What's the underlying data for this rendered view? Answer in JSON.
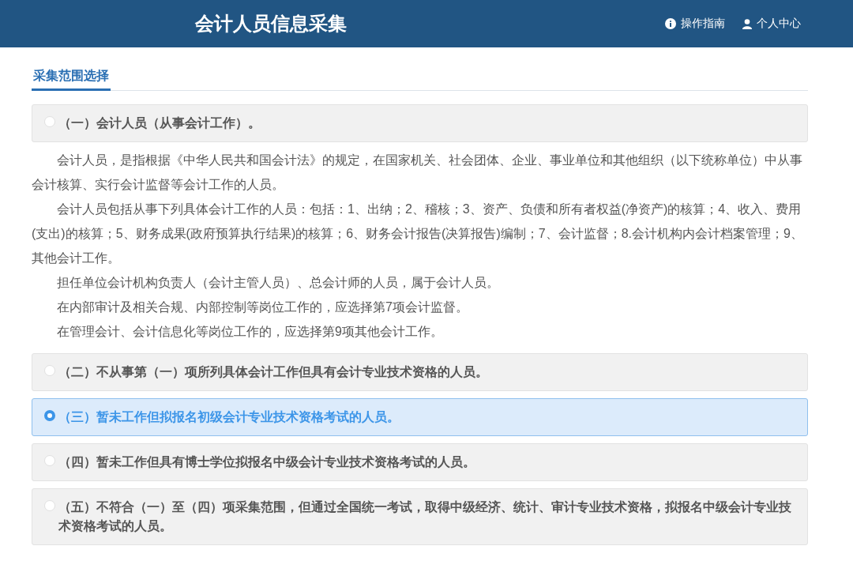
{
  "header": {
    "title": "会计人员信息采集",
    "links": [
      {
        "kind": "info",
        "label": "操作指南"
      },
      {
        "kind": "user",
        "label": "个人中心"
      }
    ]
  },
  "tabs": [
    {
      "label": "采集范围选择",
      "selected": true
    }
  ],
  "options": [
    {
      "label": "（一）会计人员（从事会计工作）。",
      "selected": false,
      "paragraphs": [
        "会计人员，是指根据《中华人民共和国会计法》的规定，在国家机关、社会团体、企业、事业单位和其他组织（以下统称单位）中从事会计核算、实行会计监督等会计工作的人员。",
        "会计人员包括从事下列具体会计工作的人员：包括：1、出纳；2、稽核；3、资产、负债和所有者权益(净资产)的核算；4、收入、费用(支出)的核算；5、财务成果(政府预算执行结果)的核算；6、财务会计报告(决算报告)编制；7、会计监督；8.会计机构内会计档案管理；9、其他会计工作。",
        "担任单位会计机构负责人（会计主管人员）、总会计师的人员，属于会计人员。",
        "在内部审计及相关合规、内部控制等岗位工作的，应选择第7项会计监督。",
        "在管理会计、会计信息化等岗位工作的，应选择第9项其他会计工作。"
      ]
    },
    {
      "label": "（二）不从事第（一）项所列具体会计工作但具有会计专业技术资格的人员。",
      "selected": false
    },
    {
      "label": "（三）暂未工作但拟报名初级会计专业技术资格考试的人员。",
      "selected": true
    },
    {
      "label": "（四）暂未工作但具有博士学位拟报名中级会计专业技术资格考试的人员。",
      "selected": false
    },
    {
      "label": "（五）不符合（一）至（四）项采集范围，但通过全国统一考试，取得中级经济、统计、审计专业技术资格，拟报名中级会计专业技术资格考试的人员。",
      "selected": false
    }
  ]
}
